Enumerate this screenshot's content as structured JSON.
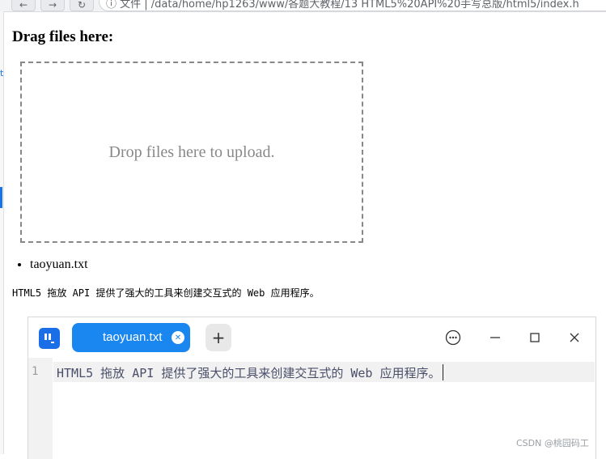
{
  "browser": {
    "back_icon": "arrow-left-icon",
    "forward_icon": "arrow-right-icon",
    "reload_icon": "reload-icon",
    "address_text": "ⓘ 文件 | /data/home/hp1263/www/各题大教程/13 HTML5%20API%20手写总版/html5/index.h"
  },
  "page": {
    "heading": "Drag files here:",
    "drop_zone_text": "Drop files here to upload.",
    "files": [
      "taoyuan.txt"
    ],
    "file_content": "HTML5 拖放 API 提供了强大的工具来创建交互式的 Web 应用程序。"
  },
  "editor": {
    "tab_title": "taoyuan.txt",
    "tab_close_icon": "close-icon",
    "add_tab_icon": "plus-icon",
    "menu_icon": "more-icon",
    "minimize_icon": "minimize-icon",
    "maximize_icon": "maximize-icon",
    "close_icon": "close-icon",
    "line_number": "1",
    "line_text": "HTML5 拖放 API 提供了强大的工具来创建交互式的 Web 应用程序。",
    "accent": "#1a86f0"
  },
  "watermark": "CSDN @桃园码工"
}
